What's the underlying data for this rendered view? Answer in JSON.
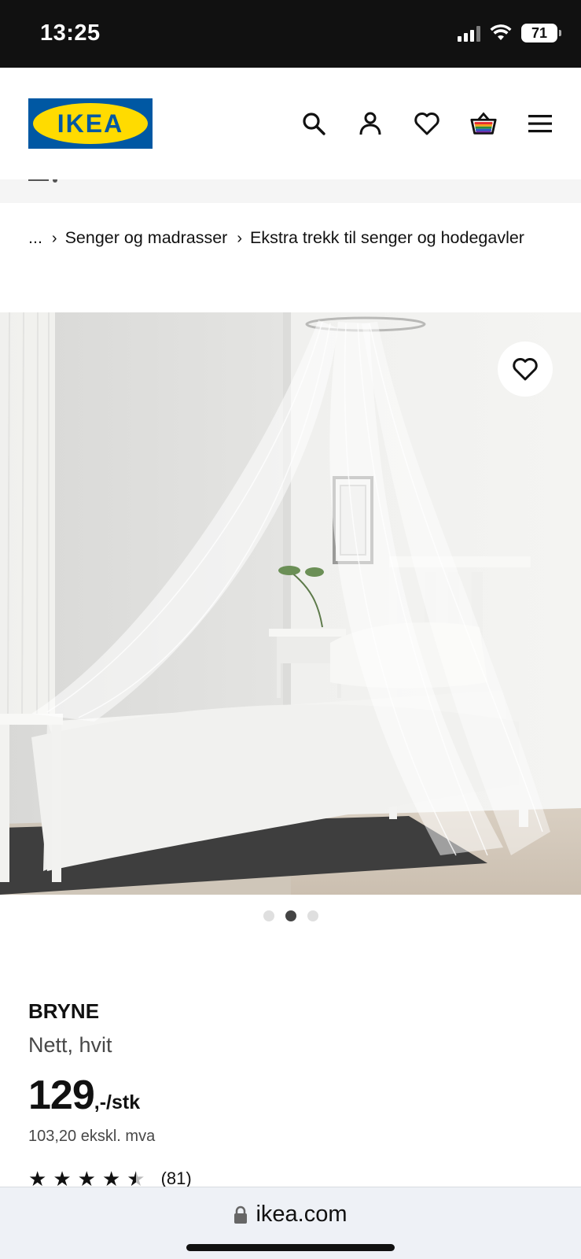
{
  "status_bar": {
    "time": "13:25",
    "battery": "71"
  },
  "header": {
    "logo_text": "IKEA",
    "icons": [
      "search-icon",
      "account-icon",
      "heart-icon",
      "basket-icon",
      "menu-icon"
    ]
  },
  "breadcrumb": {
    "ellipsis": "...",
    "items": [
      "Senger og madrasser",
      "Ekstra trekk til senger og hodegavler"
    ]
  },
  "gallery": {
    "dot_count": 3,
    "active_dot": 2
  },
  "product": {
    "name": "BRYNE",
    "description": "Nett, hvit",
    "price": "129",
    "price_suffix": ",-/stk",
    "price_ex_vat": "103,20 ekskl. mva",
    "rating": 4.5,
    "review_count": "(81)"
  },
  "browser": {
    "url": "ikea.com"
  },
  "colors": {
    "ikea_blue": "#0058a3",
    "ikea_yellow": "#ffdb00",
    "status_bar": "#111111"
  }
}
